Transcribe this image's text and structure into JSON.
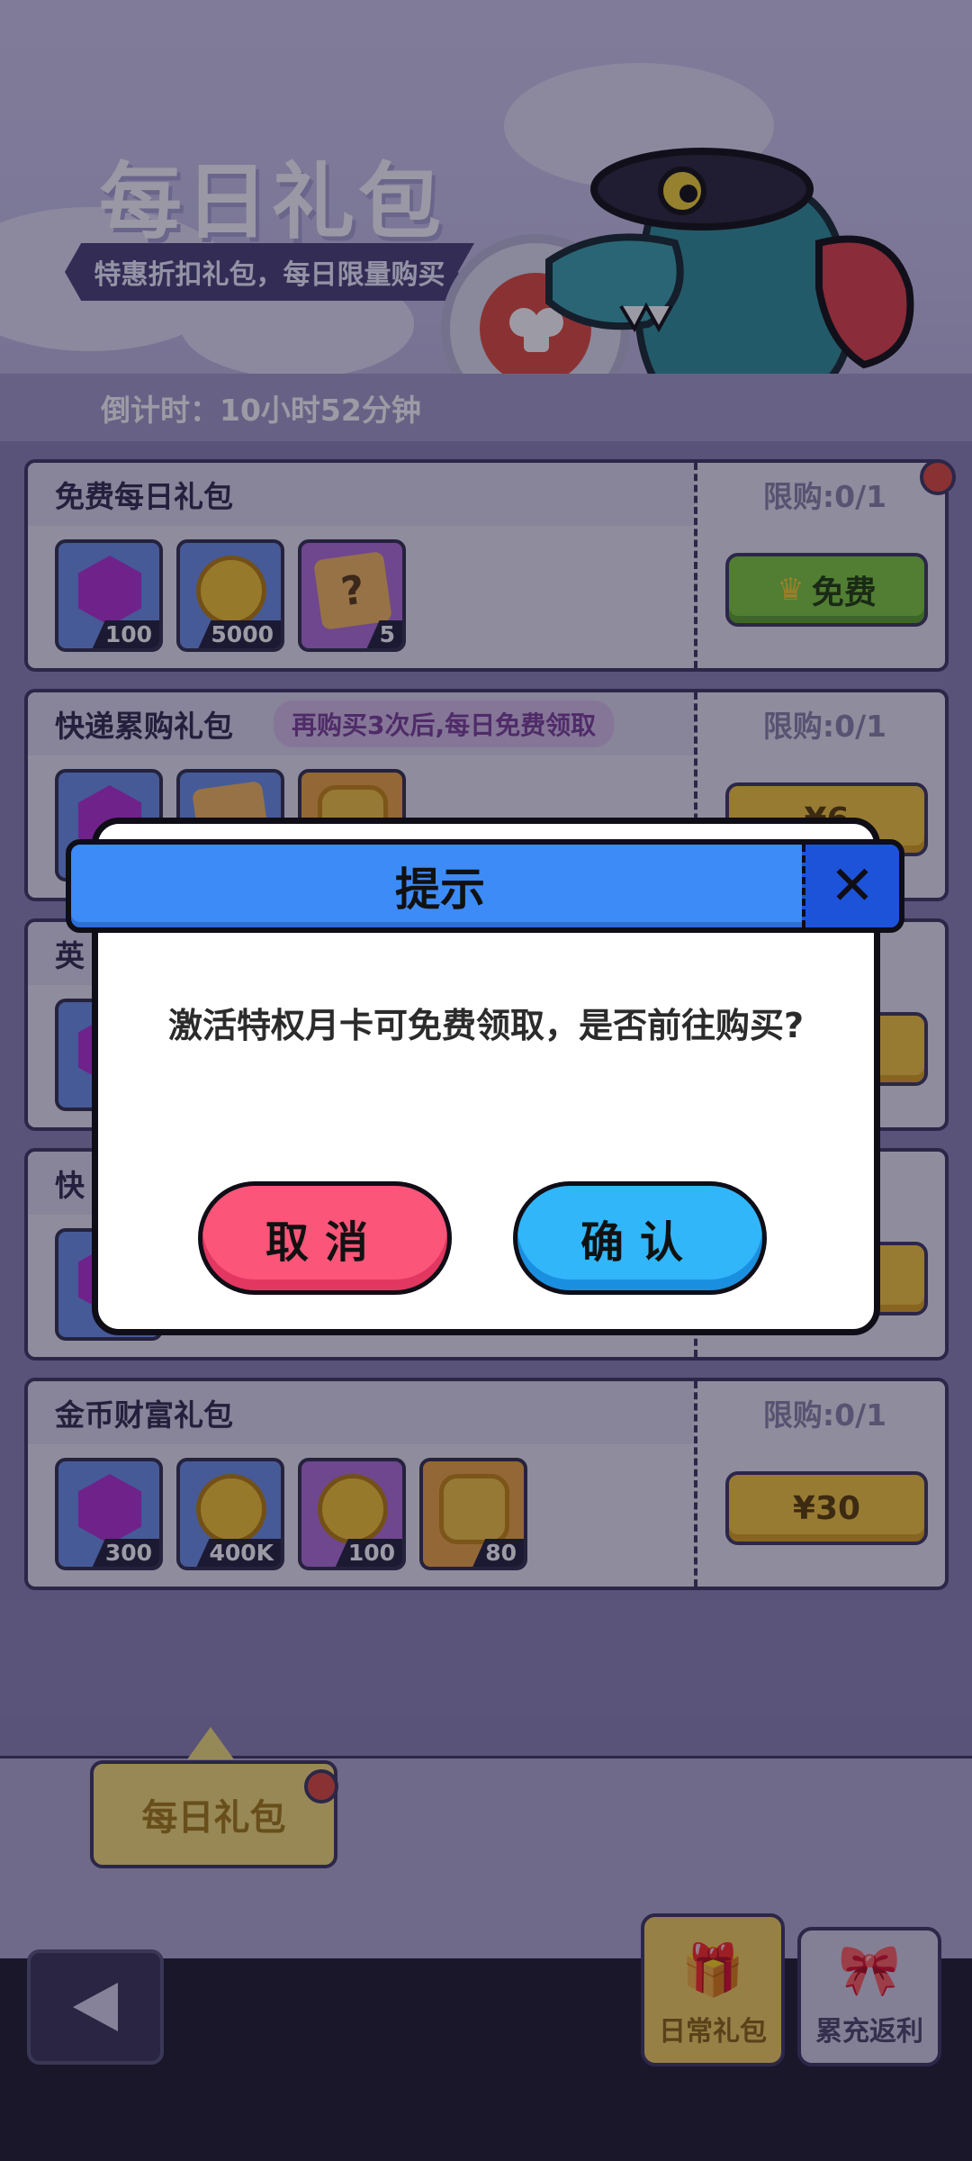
{
  "header": {
    "title": "每日礼包",
    "subtitle": "特惠折扣礼包，每日限量购买",
    "countdown": "倒计时：10小时52分钟"
  },
  "packs": [
    {
      "name": "免费每日礼包",
      "note": "",
      "limit": "限购:0/1",
      "button": "免费",
      "button_icon": "crown-icon",
      "items": [
        {
          "icon": "gem-icon",
          "count": "100"
        },
        {
          "icon": "coin-icon",
          "count": "5000"
        },
        {
          "icon": "mystery-box-icon",
          "count": "5"
        }
      ]
    },
    {
      "name": "快递累购礼包",
      "note": "再购买3次后,每日免费领取",
      "limit": "限购:0/1",
      "button": "¥6",
      "items": [
        {
          "icon": "gem-icon",
          "count": ""
        },
        {
          "icon": "chest-icon",
          "count": ""
        },
        {
          "icon": "pouch-icon",
          "count": ""
        }
      ]
    },
    {
      "name": "英",
      "note": "",
      "limit": "",
      "button": "",
      "items": []
    },
    {
      "name": "快",
      "note": "",
      "limit": "",
      "button": "",
      "items": []
    },
    {
      "name": "金币财富礼包",
      "note": "",
      "limit": "限购:0/1",
      "button": "¥30",
      "items": [
        {
          "icon": "gem-icon",
          "count": "300"
        },
        {
          "icon": "coin-icon",
          "count": "400K"
        },
        {
          "icon": "coin-icon",
          "count": "100"
        },
        {
          "icon": "pouch-icon",
          "count": "80"
        }
      ]
    }
  ],
  "bottom": {
    "daily_tab": "每日礼包",
    "nav_tabs": [
      "日常礼包",
      "累充返利"
    ]
  },
  "dialog": {
    "title": "提示",
    "message": "激活特权月卡可免费领取，是否前往购买?",
    "cancel": "取消",
    "confirm": "确认"
  },
  "colors": {
    "dialog_header": "#3d8bf7",
    "cancel_button": "#fb5579",
    "confirm_button": "#31b6f9",
    "free_button": "#7fce3a",
    "price_button": "#f9c93b"
  }
}
